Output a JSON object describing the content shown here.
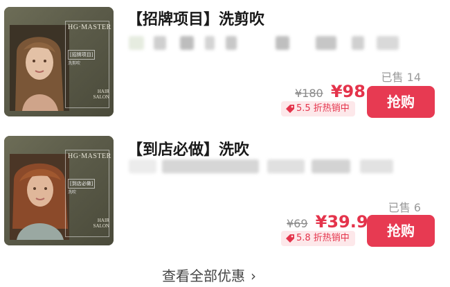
{
  "items": [
    {
      "image": {
        "brand": "HG·MASTER",
        "tag": "[招牌项目]",
        "sub": "洗剪吹",
        "hair": "HAIR\nSALON"
      },
      "title": "【招牌项目】洗剪吹",
      "sold": "已售 14",
      "original_price": "¥180",
      "price": "¥98",
      "discount": "5.5 折热销中",
      "buy_label": "抢购"
    },
    {
      "image": {
        "brand": "HG·MASTER",
        "tag": "[到店必做]",
        "sub": "洗吹",
        "hair": "HAIR\nSALON"
      },
      "title": "【到店必做】洗吹",
      "sold": "已售 6",
      "original_price": "¥69",
      "price": "¥39.9",
      "discount": "5.8 折热销中",
      "buy_label": "抢购"
    }
  ],
  "view_all": "查看全部优惠",
  "colors": {
    "accent": "#e73a52",
    "price": "#e4334b",
    "discount_bg": "#fde8ea"
  }
}
